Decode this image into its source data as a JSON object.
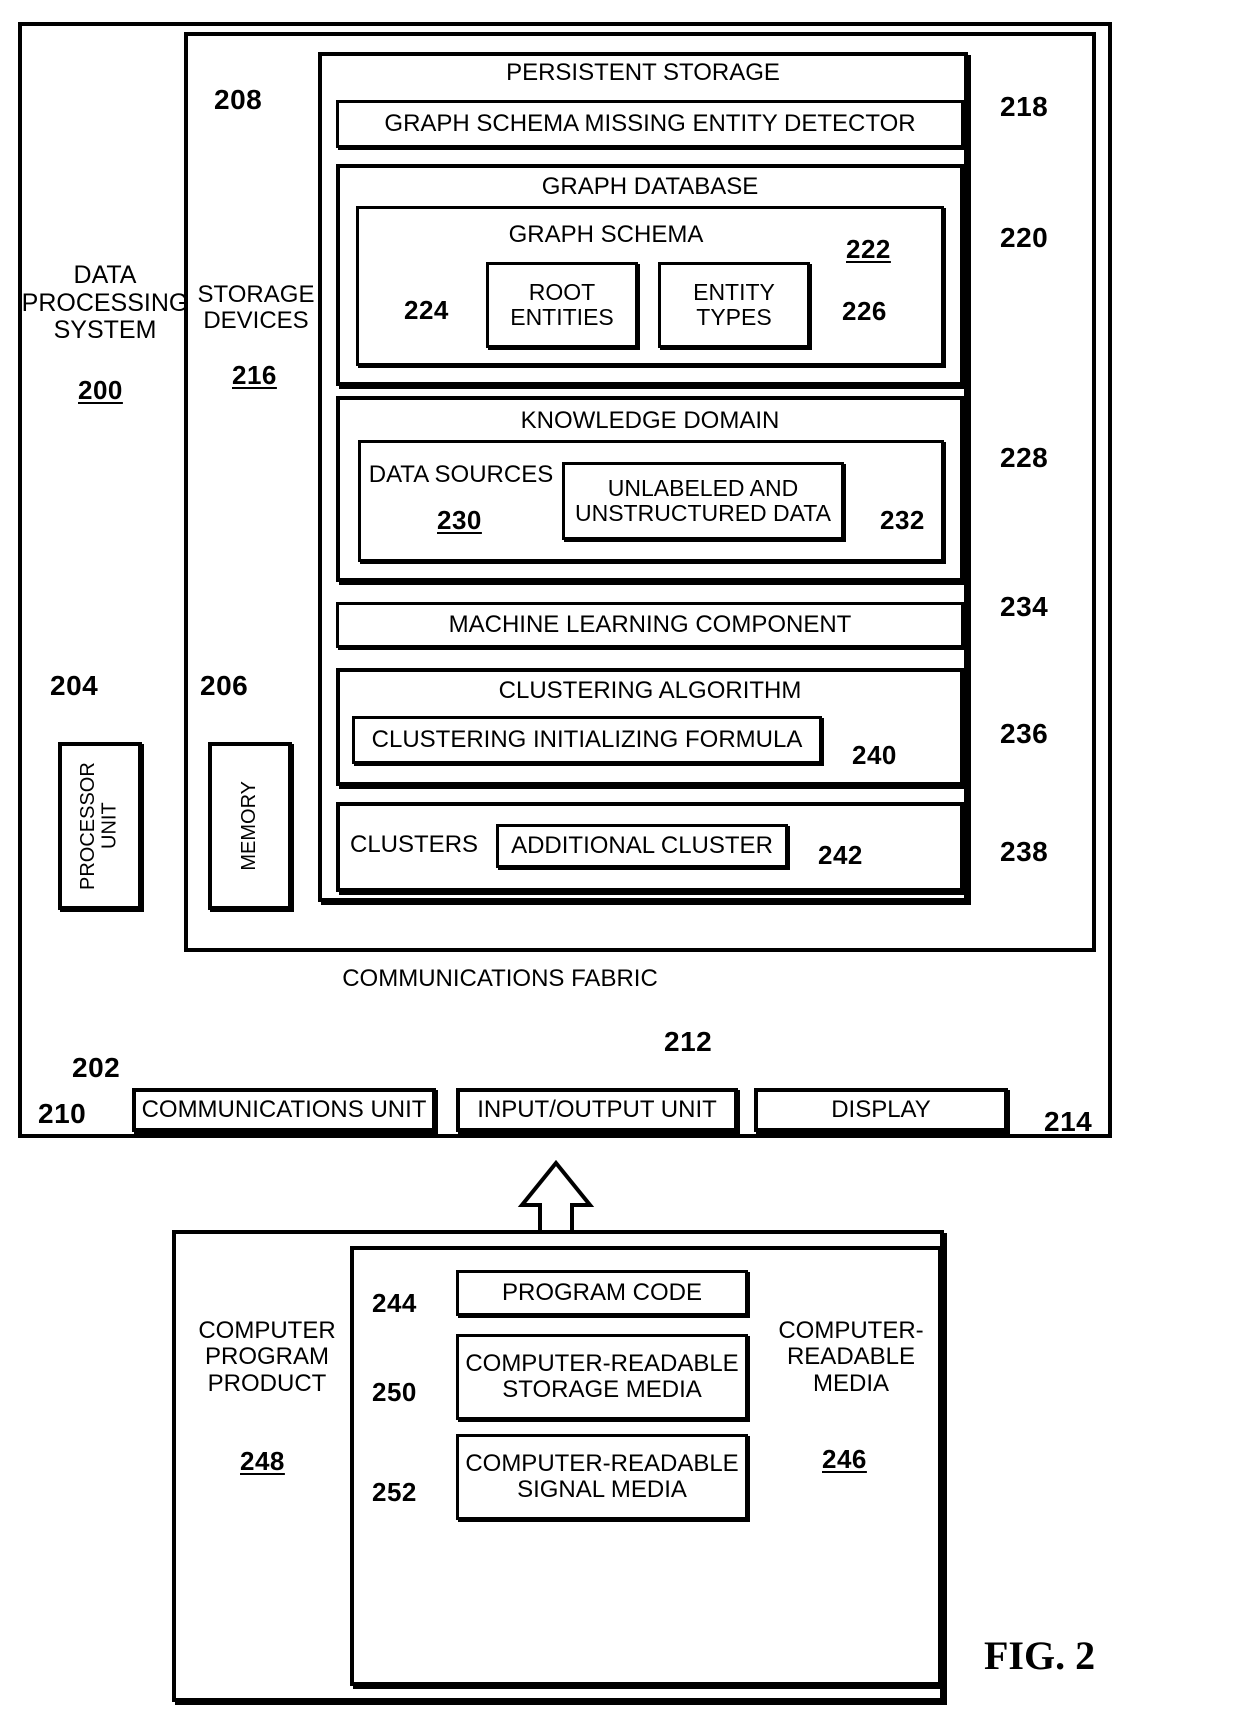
{
  "figure": {
    "label": "FIG. 2",
    "title": "Data Processing System Block Diagram"
  },
  "system": {
    "name": "DATA\nPROCESSING\nSYSTEM",
    "ref": "200",
    "storage_devices": {
      "name": "STORAGE\nDEVICES",
      "ref": "216"
    },
    "persistent_storage": {
      "name": "PERSISTENT STORAGE",
      "ref": "208",
      "children": [
        {
          "name": "GRAPH SCHEMA MISSING ENTITY DETECTOR",
          "ref": "218"
        },
        {
          "name": "GRAPH DATABASE",
          "ref": "220",
          "children": [
            {
              "name": "GRAPH SCHEMA",
              "ref": "222",
              "children": [
                {
                  "name": "ROOT\nENTITIES",
                  "ref": "224"
                },
                {
                  "name": "ENTITY\nTYPES",
                  "ref": "226"
                }
              ]
            }
          ]
        },
        {
          "name": "KNOWLEDGE DOMAIN",
          "ref": "228",
          "children": [
            {
              "name": "DATA SOURCES",
              "ref": "230",
              "children": [
                {
                  "name": "UNLABELED AND\nUNSTRUCTURED DATA",
                  "ref": "232"
                }
              ]
            }
          ]
        },
        {
          "name": "MACHINE LEARNING COMPONENT",
          "ref": "234"
        },
        {
          "name": "CLUSTERING ALGORITHM",
          "ref": "236",
          "children": [
            {
              "name": "CLUSTERING INITIALIZING FORMULA",
              "ref": "240"
            }
          ]
        },
        {
          "name": "CLUSTERS",
          "ref": "238",
          "children": [
            {
              "name": "ADDITIONAL CLUSTER",
              "ref": "242"
            }
          ]
        }
      ]
    },
    "processor_unit": {
      "name": "PROCESSOR\nUNIT",
      "ref": "204"
    },
    "memory": {
      "name": "MEMORY",
      "ref": "206"
    },
    "communications_fabric": {
      "name": "COMMUNICATIONS FABRIC",
      "ref": "202"
    },
    "io_row": [
      {
        "name": "COMMUNICATIONS UNIT",
        "ref": "210"
      },
      {
        "name": "INPUT/OUTPUT UNIT",
        "ref": "212"
      },
      {
        "name": "DISPLAY",
        "ref": "214"
      }
    ]
  },
  "computer_program_product": {
    "name": "COMPUTER\nPROGRAM\nPRODUCT",
    "ref": "248",
    "media": {
      "name": "COMPUTER-\nREADABLE\nMEDIA",
      "ref": "246",
      "children": [
        {
          "name": "PROGRAM CODE",
          "ref": "244"
        },
        {
          "name": "COMPUTER-READABLE\nSTORAGE MEDIA",
          "ref": "250"
        },
        {
          "name": "COMPUTER-READABLE\nSIGNAL MEDIA",
          "ref": "252"
        }
      ]
    }
  },
  "colors": {
    "ink": "#000000",
    "paper": "#ffffff"
  }
}
